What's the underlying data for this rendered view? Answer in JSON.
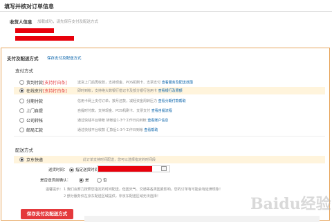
{
  "page": {
    "title": "填写并核对订单信息",
    "receiver": {
      "label": "收货人信息",
      "note": "加载成功，请先保存支付及配送方式"
    },
    "payment_delivery": {
      "title": "支付及配送方式",
      "link": "保存支付及配送方式"
    },
    "payment": {
      "title": "支付方式",
      "options": [
        {
          "name": "货到付款",
          "tag": "[支持打白条]",
          "desc": "送货上门后再收款，支持现金、POS机刷卡、支票支付",
          "link": "查看服务及配送范围",
          "selected": false
        },
        {
          "name": "在线支付",
          "tag": "[支持打白条]",
          "desc": "即时到帐，支持绝大数银行借记卡及部分银行信用卡",
          "link": "查看银行及限额",
          "selected": true
        },
        {
          "name": "分期付款",
          "tag": "",
          "desc": "信用卡网上支付订单，按月还款，减轻资金周转压力",
          "link": "查看分期付款帮助",
          "selected": false
        },
        {
          "name": "上门自提",
          "tag": "",
          "desc": "自提时付款，支持现金、POS机刷卡、支票支付",
          "link": "查看自提流程",
          "selected": false
        },
        {
          "name": "公司转帐",
          "tag": "",
          "desc": "通过快钱平台转帐 转帐后1-3个工作日内到帐",
          "link": "查看账户信息",
          "selected": false
        },
        {
          "name": "邮局汇款",
          "tag": "",
          "desc": "通过快钱平台收款 汇款后1-3个工作日到帐",
          "link": "查看帮助",
          "selected": false
        }
      ]
    },
    "delivery": {
      "title": "配送方式",
      "option": {
        "name": "京东快递",
        "desc": "此订单支持时间配送，您可以选择指定的时间段"
      },
      "time_label": "送货时间：",
      "time_option": "指定送货时间",
      "confirm_label": "是否送货前确认：",
      "confirm_yes": "是",
      "confirm_no": "否",
      "tip_label": "温馨提示：",
      "tip_line1": "1 我们会努力按照您指定的时间配送，但因天气、交通等各类因素影响，您的订单有可能会有延误现象！",
      "tip_line2": "2 部分服务仅在京东配送区域提供，非京东配送区域无法选择！"
    },
    "submit_label": "保存支付及配送方式",
    "watermark": "Baidu经验",
    "colors": {
      "accent": "#e4393c",
      "link": "#005ea7",
      "border": "#e6a35a",
      "highlight": "#fff4dc",
      "redaction": "#e8000b"
    }
  }
}
